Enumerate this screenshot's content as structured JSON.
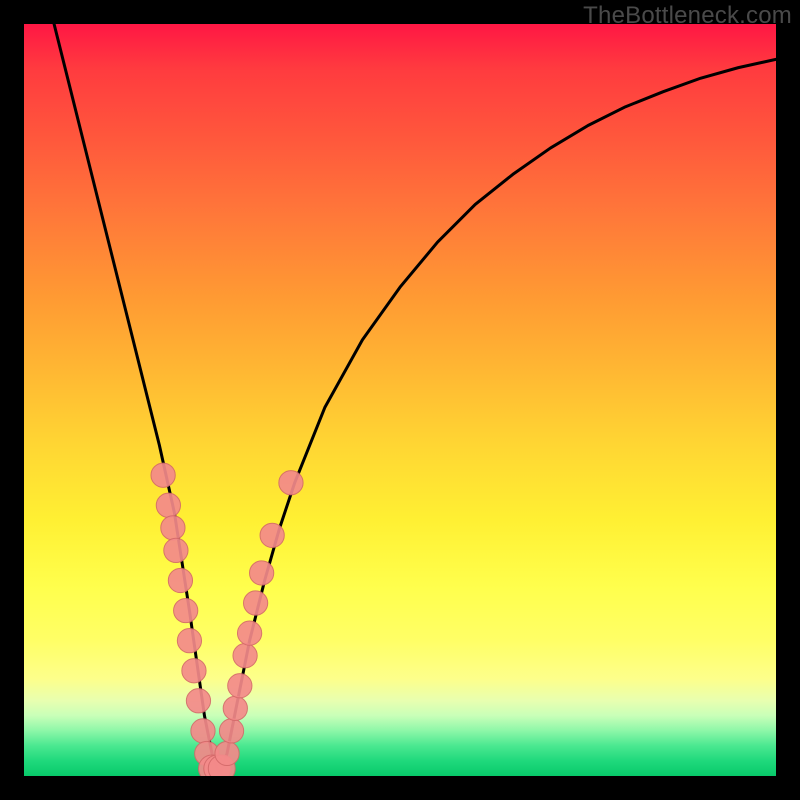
{
  "watermark": "TheBottleneck.com",
  "chart_data": {
    "type": "line",
    "title": "",
    "xlabel": "",
    "ylabel": "",
    "xlim": [
      0,
      100
    ],
    "ylim": [
      0,
      100
    ],
    "series": [
      {
        "name": "bottleneck-curve",
        "x": [
          4,
          6,
          8,
          10,
          12,
          14,
          16,
          18,
          20,
          22,
          23,
          24,
          25,
          26,
          27,
          28,
          30,
          32,
          34,
          36,
          40,
          45,
          50,
          55,
          60,
          65,
          70,
          75,
          80,
          85,
          90,
          95,
          100
        ],
        "values": [
          100,
          92,
          84,
          76,
          68,
          60,
          52,
          44,
          35,
          22,
          15,
          8,
          3,
          0,
          3,
          8,
          18,
          26,
          33,
          39,
          49,
          58,
          65,
          71,
          76,
          80,
          83.5,
          86.5,
          89,
          91,
          92.8,
          94.2,
          95.3
        ]
      }
    ],
    "markers": [
      {
        "x": 18.5,
        "y": 40,
        "r": 1.2
      },
      {
        "x": 19.2,
        "y": 36,
        "r": 1.2
      },
      {
        "x": 19.8,
        "y": 33,
        "r": 1.2
      },
      {
        "x": 20.2,
        "y": 30,
        "r": 1.2
      },
      {
        "x": 20.8,
        "y": 26,
        "r": 1.2
      },
      {
        "x": 21.5,
        "y": 22,
        "r": 1.2
      },
      {
        "x": 22.0,
        "y": 18,
        "r": 1.2
      },
      {
        "x": 22.6,
        "y": 14,
        "r": 1.2
      },
      {
        "x": 23.2,
        "y": 10,
        "r": 1.2
      },
      {
        "x": 23.8,
        "y": 6,
        "r": 1.2
      },
      {
        "x": 24.3,
        "y": 3,
        "r": 1.2
      },
      {
        "x": 25.0,
        "y": 1,
        "r": 1.4
      },
      {
        "x": 25.7,
        "y": 1,
        "r": 1.4
      },
      {
        "x": 26.3,
        "y": 1,
        "r": 1.4
      },
      {
        "x": 27.0,
        "y": 3,
        "r": 1.2
      },
      {
        "x": 27.6,
        "y": 6,
        "r": 1.2
      },
      {
        "x": 28.1,
        "y": 9,
        "r": 1.2
      },
      {
        "x": 28.7,
        "y": 12,
        "r": 1.2
      },
      {
        "x": 29.4,
        "y": 16,
        "r": 1.2
      },
      {
        "x": 30.0,
        "y": 19,
        "r": 1.2
      },
      {
        "x": 30.8,
        "y": 23,
        "r": 1.2
      },
      {
        "x": 31.6,
        "y": 27,
        "r": 1.2
      },
      {
        "x": 33.0,
        "y": 32,
        "r": 1.2
      },
      {
        "x": 35.5,
        "y": 39,
        "r": 1.2
      }
    ],
    "colors": {
      "curve": "#000000",
      "marker_fill": "#f48a8a",
      "marker_stroke": "#d46a6a"
    }
  }
}
